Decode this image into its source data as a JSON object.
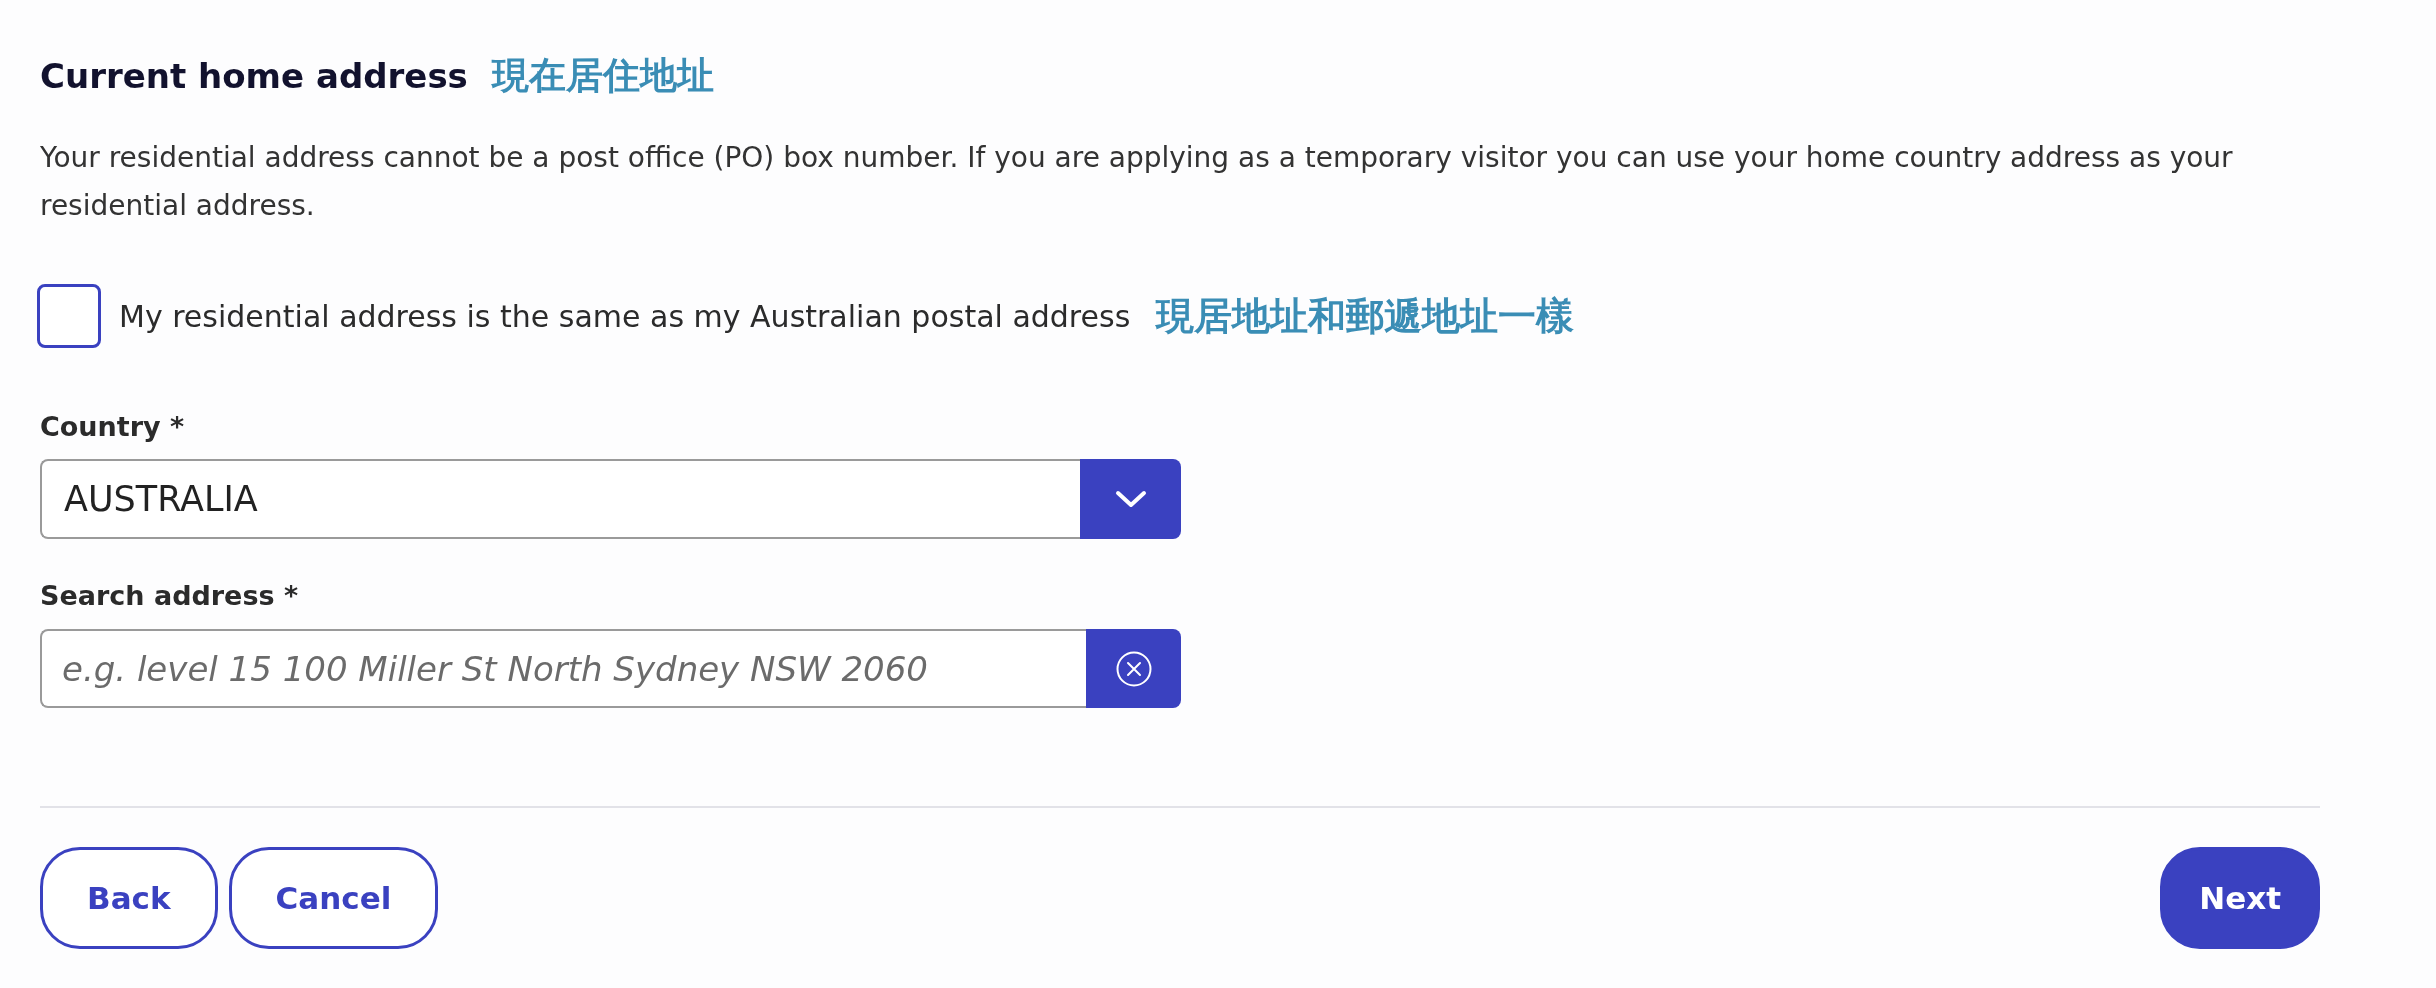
{
  "heading": {
    "title": "Current home address",
    "translation": "現在居住地址"
  },
  "intro": "Your residential address cannot be a post office (PO) box number. If you are applying as a temporary visitor you can use your home country address as your residential address.",
  "same_address": {
    "label": "My residential address is the same as my Australian postal address",
    "translation": "現居地址和郵遞地址一樣",
    "checked": false
  },
  "fields": [
    {
      "kind": "select",
      "label": "Country *",
      "value": "AUSTRALIA"
    },
    {
      "kind": "search",
      "label": "Search address *",
      "placeholder": "e.g. level 15 100 Miller St North Sydney NSW 2060"
    }
  ],
  "buttons": [
    {
      "kind": "secondary",
      "label": "Back"
    },
    {
      "kind": "secondary",
      "label": "Cancel"
    },
    {
      "kind": "primary",
      "label": "Next"
    }
  ]
}
